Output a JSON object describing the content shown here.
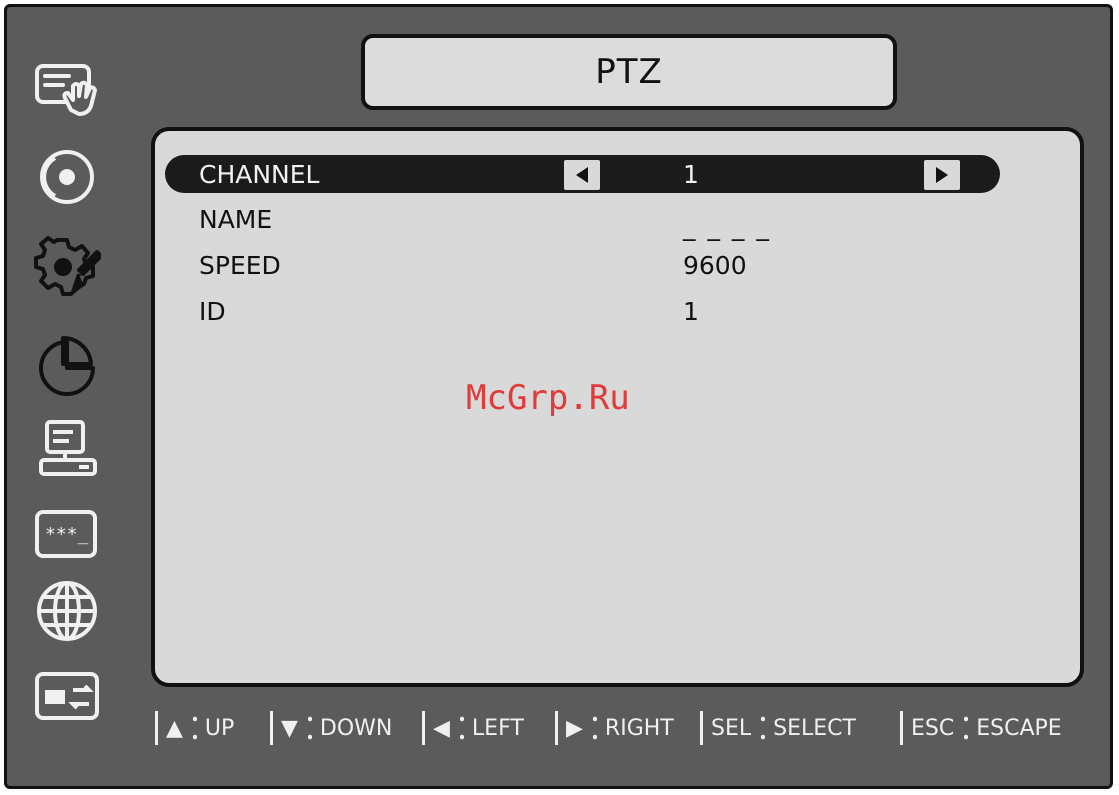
{
  "window": {
    "title": "PTZ"
  },
  "sidebar": {
    "icons": [
      {
        "name": "touch-menu-icon"
      },
      {
        "name": "disc-icon"
      },
      {
        "name": "settings-tools-icon"
      },
      {
        "name": "pie-chart-icon"
      },
      {
        "name": "computer-icon"
      },
      {
        "name": "password-icon"
      },
      {
        "name": "globe-icon"
      },
      {
        "name": "transfer-icon"
      }
    ]
  },
  "settings": {
    "channel": {
      "label": "CHANNEL",
      "value": "1"
    },
    "name": {
      "label": "NAME",
      "value": "_ _ _ _"
    },
    "speed": {
      "label": "SPEED",
      "value": "9600"
    },
    "id": {
      "label": "ID",
      "value": "1"
    }
  },
  "watermark": "McGrp.Ru",
  "footer": {
    "up": {
      "key": "▲",
      "label": "UP"
    },
    "down": {
      "key": "▼",
      "label": "DOWN"
    },
    "left": {
      "key": "◀",
      "label": "LEFT"
    },
    "right": {
      "key": "▶",
      "label": "RIGHT"
    },
    "select": {
      "key": "SEL",
      "label": "SELECT"
    },
    "escape": {
      "key": "ESC",
      "label": "ESCAPE"
    }
  },
  "colors": {
    "frame": "#5b5b5b",
    "panel": "#d9d9d9",
    "highlight": "#1b1b1b",
    "watermark": "#e23a3a"
  }
}
